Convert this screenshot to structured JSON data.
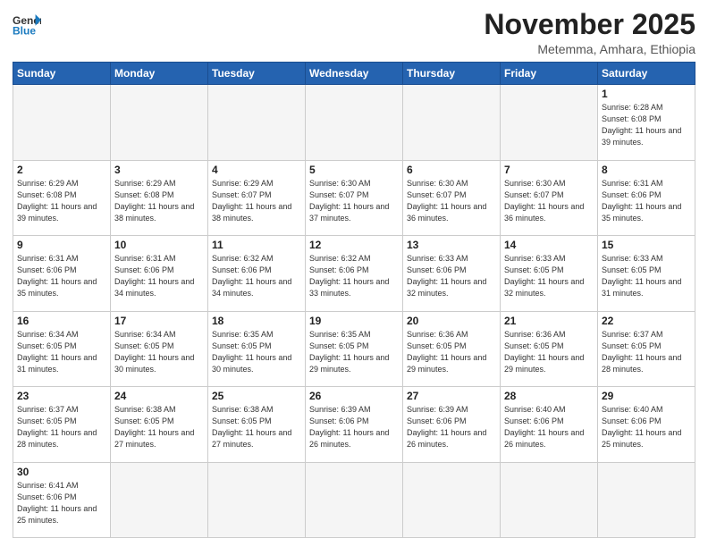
{
  "logo": {
    "line1": "General",
    "line2": "Blue"
  },
  "header": {
    "month": "November 2025",
    "location": "Metemma, Amhara, Ethiopia"
  },
  "days_of_week": [
    "Sunday",
    "Monday",
    "Tuesday",
    "Wednesday",
    "Thursday",
    "Friday",
    "Saturday"
  ],
  "weeks": [
    [
      {
        "day": "",
        "info": ""
      },
      {
        "day": "",
        "info": ""
      },
      {
        "day": "",
        "info": ""
      },
      {
        "day": "",
        "info": ""
      },
      {
        "day": "",
        "info": ""
      },
      {
        "day": "",
        "info": ""
      },
      {
        "day": "1",
        "info": "Sunrise: 6:28 AM\nSunset: 6:08 PM\nDaylight: 11 hours\nand 39 minutes."
      }
    ],
    [
      {
        "day": "2",
        "info": "Sunrise: 6:29 AM\nSunset: 6:08 PM\nDaylight: 11 hours\nand 39 minutes."
      },
      {
        "day": "3",
        "info": "Sunrise: 6:29 AM\nSunset: 6:08 PM\nDaylight: 11 hours\nand 38 minutes."
      },
      {
        "day": "4",
        "info": "Sunrise: 6:29 AM\nSunset: 6:07 PM\nDaylight: 11 hours\nand 38 minutes."
      },
      {
        "day": "5",
        "info": "Sunrise: 6:30 AM\nSunset: 6:07 PM\nDaylight: 11 hours\nand 37 minutes."
      },
      {
        "day": "6",
        "info": "Sunrise: 6:30 AM\nSunset: 6:07 PM\nDaylight: 11 hours\nand 36 minutes."
      },
      {
        "day": "7",
        "info": "Sunrise: 6:30 AM\nSunset: 6:07 PM\nDaylight: 11 hours\nand 36 minutes."
      },
      {
        "day": "8",
        "info": "Sunrise: 6:31 AM\nSunset: 6:06 PM\nDaylight: 11 hours\nand 35 minutes."
      }
    ],
    [
      {
        "day": "9",
        "info": "Sunrise: 6:31 AM\nSunset: 6:06 PM\nDaylight: 11 hours\nand 35 minutes."
      },
      {
        "day": "10",
        "info": "Sunrise: 6:31 AM\nSunset: 6:06 PM\nDaylight: 11 hours\nand 34 minutes."
      },
      {
        "day": "11",
        "info": "Sunrise: 6:32 AM\nSunset: 6:06 PM\nDaylight: 11 hours\nand 34 minutes."
      },
      {
        "day": "12",
        "info": "Sunrise: 6:32 AM\nSunset: 6:06 PM\nDaylight: 11 hours\nand 33 minutes."
      },
      {
        "day": "13",
        "info": "Sunrise: 6:33 AM\nSunset: 6:06 PM\nDaylight: 11 hours\nand 32 minutes."
      },
      {
        "day": "14",
        "info": "Sunrise: 6:33 AM\nSunset: 6:05 PM\nDaylight: 11 hours\nand 32 minutes."
      },
      {
        "day": "15",
        "info": "Sunrise: 6:33 AM\nSunset: 6:05 PM\nDaylight: 11 hours\nand 31 minutes."
      }
    ],
    [
      {
        "day": "16",
        "info": "Sunrise: 6:34 AM\nSunset: 6:05 PM\nDaylight: 11 hours\nand 31 minutes."
      },
      {
        "day": "17",
        "info": "Sunrise: 6:34 AM\nSunset: 6:05 PM\nDaylight: 11 hours\nand 30 minutes."
      },
      {
        "day": "18",
        "info": "Sunrise: 6:35 AM\nSunset: 6:05 PM\nDaylight: 11 hours\nand 30 minutes."
      },
      {
        "day": "19",
        "info": "Sunrise: 6:35 AM\nSunset: 6:05 PM\nDaylight: 11 hours\nand 29 minutes."
      },
      {
        "day": "20",
        "info": "Sunrise: 6:36 AM\nSunset: 6:05 PM\nDaylight: 11 hours\nand 29 minutes."
      },
      {
        "day": "21",
        "info": "Sunrise: 6:36 AM\nSunset: 6:05 PM\nDaylight: 11 hours\nand 29 minutes."
      },
      {
        "day": "22",
        "info": "Sunrise: 6:37 AM\nSunset: 6:05 PM\nDaylight: 11 hours\nand 28 minutes."
      }
    ],
    [
      {
        "day": "23",
        "info": "Sunrise: 6:37 AM\nSunset: 6:05 PM\nDaylight: 11 hours\nand 28 minutes."
      },
      {
        "day": "24",
        "info": "Sunrise: 6:38 AM\nSunset: 6:05 PM\nDaylight: 11 hours\nand 27 minutes."
      },
      {
        "day": "25",
        "info": "Sunrise: 6:38 AM\nSunset: 6:05 PM\nDaylight: 11 hours\nand 27 minutes."
      },
      {
        "day": "26",
        "info": "Sunrise: 6:39 AM\nSunset: 6:06 PM\nDaylight: 11 hours\nand 26 minutes."
      },
      {
        "day": "27",
        "info": "Sunrise: 6:39 AM\nSunset: 6:06 PM\nDaylight: 11 hours\nand 26 minutes."
      },
      {
        "day": "28",
        "info": "Sunrise: 6:40 AM\nSunset: 6:06 PM\nDaylight: 11 hours\nand 26 minutes."
      },
      {
        "day": "29",
        "info": "Sunrise: 6:40 AM\nSunset: 6:06 PM\nDaylight: 11 hours\nand 25 minutes."
      }
    ],
    [
      {
        "day": "30",
        "info": "Sunrise: 6:41 AM\nSunset: 6:06 PM\nDaylight: 11 hours\nand 25 minutes."
      },
      {
        "day": "",
        "info": ""
      },
      {
        "day": "",
        "info": ""
      },
      {
        "day": "",
        "info": ""
      },
      {
        "day": "",
        "info": ""
      },
      {
        "day": "",
        "info": ""
      },
      {
        "day": "",
        "info": ""
      }
    ]
  ]
}
